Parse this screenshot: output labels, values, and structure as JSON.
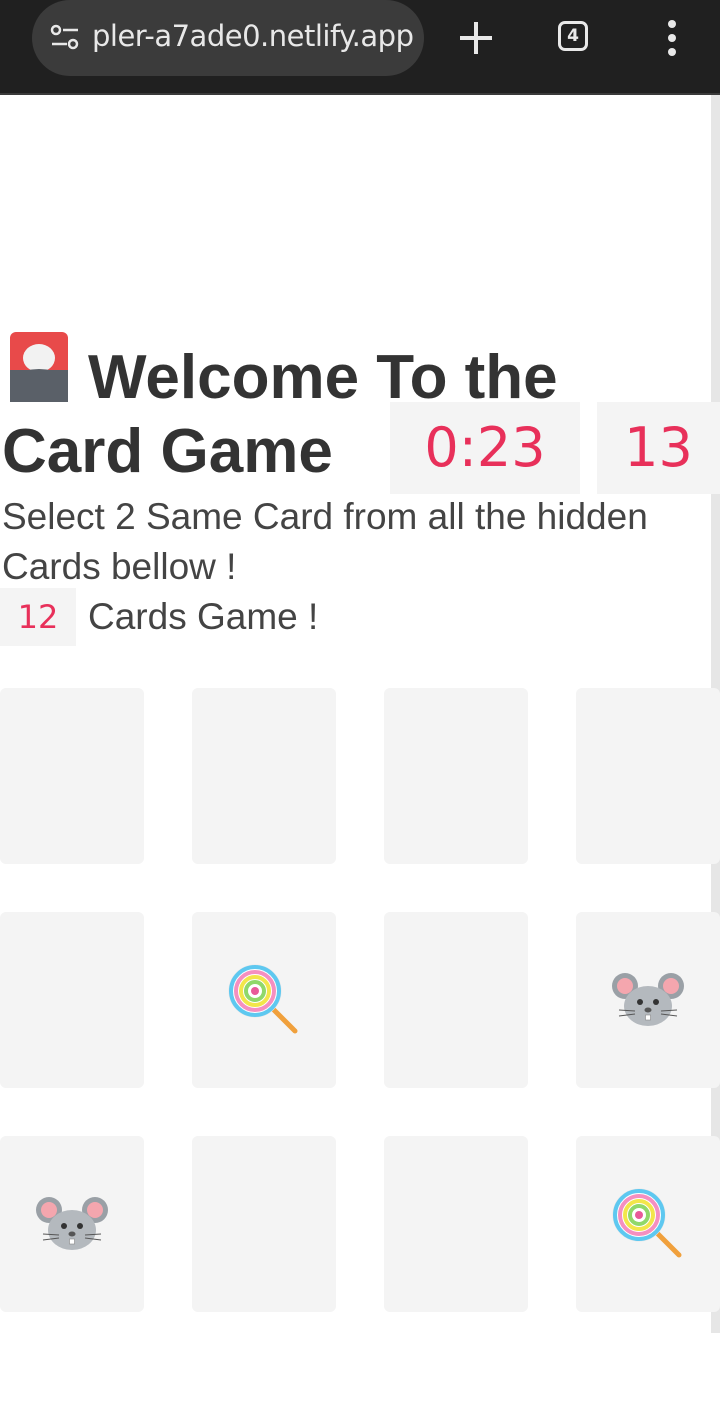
{
  "browser": {
    "url": "pler-a7ade0.netlify.app",
    "tab_count": "4"
  },
  "game": {
    "title": "Welcome To the Card Game",
    "timer": "0:23",
    "moves": "13",
    "instructions": "Select 2 Same Card from all the hidden Cards bellow !",
    "card_count": "12",
    "card_count_suffix": "Cards Game !"
  },
  "cards": [
    {
      "state": "hidden",
      "icon": ""
    },
    {
      "state": "hidden",
      "icon": ""
    },
    {
      "state": "hidden",
      "icon": ""
    },
    {
      "state": "hidden",
      "icon": ""
    },
    {
      "state": "hidden",
      "icon": ""
    },
    {
      "state": "revealed",
      "icon": "lollipop-icon"
    },
    {
      "state": "hidden",
      "icon": ""
    },
    {
      "state": "revealed",
      "icon": "mouse-face-icon"
    },
    {
      "state": "revealed",
      "icon": "mouse-face-icon"
    },
    {
      "state": "hidden",
      "icon": ""
    },
    {
      "state": "hidden",
      "icon": ""
    },
    {
      "state": "revealed",
      "icon": "lollipop-icon"
    }
  ],
  "colors": {
    "accent": "#e8305a",
    "text": "#333333",
    "card_bg": "#f4f4f4",
    "toolbar_bg": "#202020"
  }
}
